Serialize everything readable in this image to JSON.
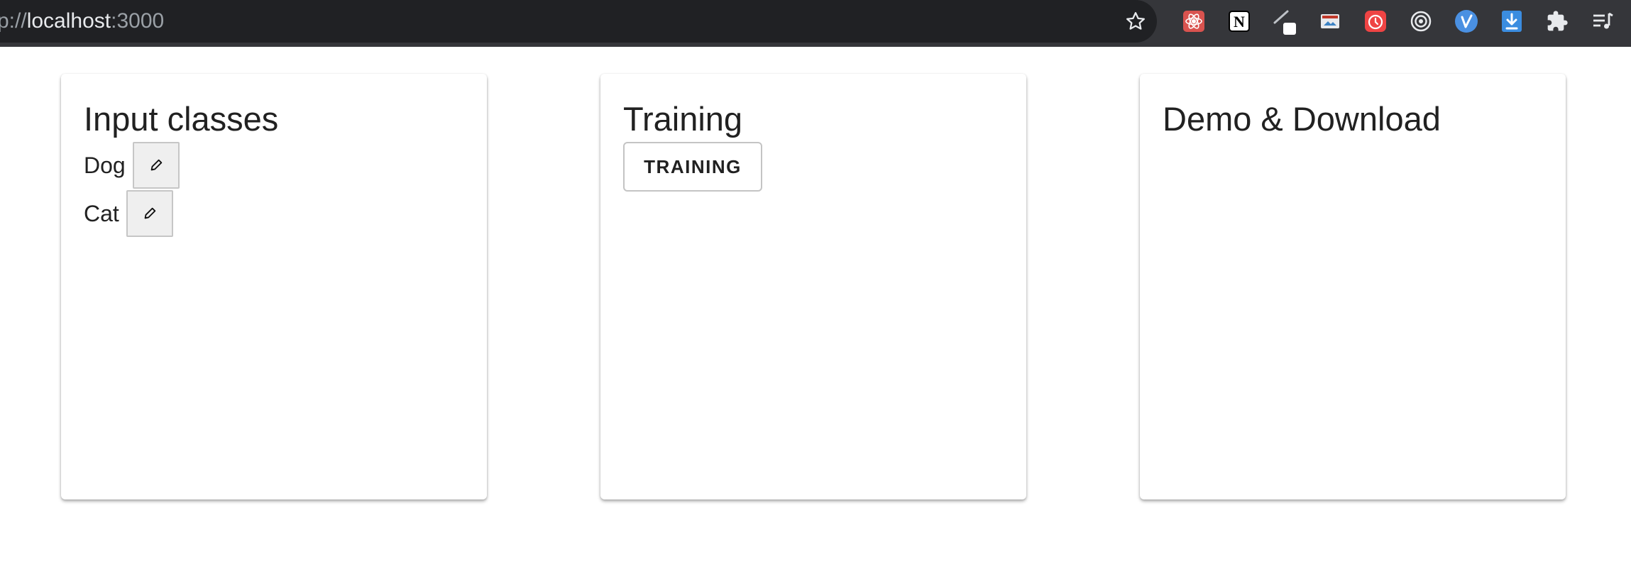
{
  "browser": {
    "url_prefix": "p://",
    "url_host": "localhost",
    "url_port": ":3000",
    "extension_icons": [
      "react-devtools-icon",
      "notion-icon",
      "pen-extension-icon",
      "screen-capture-icon",
      "clock-extension-icon",
      "target-extension-icon",
      "blue-circle-extension-icon",
      "download-icon",
      "puzzle-icon",
      "playlist-icon"
    ]
  },
  "cards": {
    "input": {
      "title": "Input classes",
      "classes": [
        {
          "name": "Dog",
          "edit_label": "✎"
        },
        {
          "name": "Cat",
          "edit_label": "✎"
        }
      ]
    },
    "training": {
      "title": "Training",
      "button_label": "TRAINING"
    },
    "demo": {
      "title": "Demo & Download"
    }
  },
  "colors": {
    "toolbar": "#35363a",
    "omnibox": "#202124",
    "card_bg": "#ffffff",
    "text": "#212121"
  }
}
